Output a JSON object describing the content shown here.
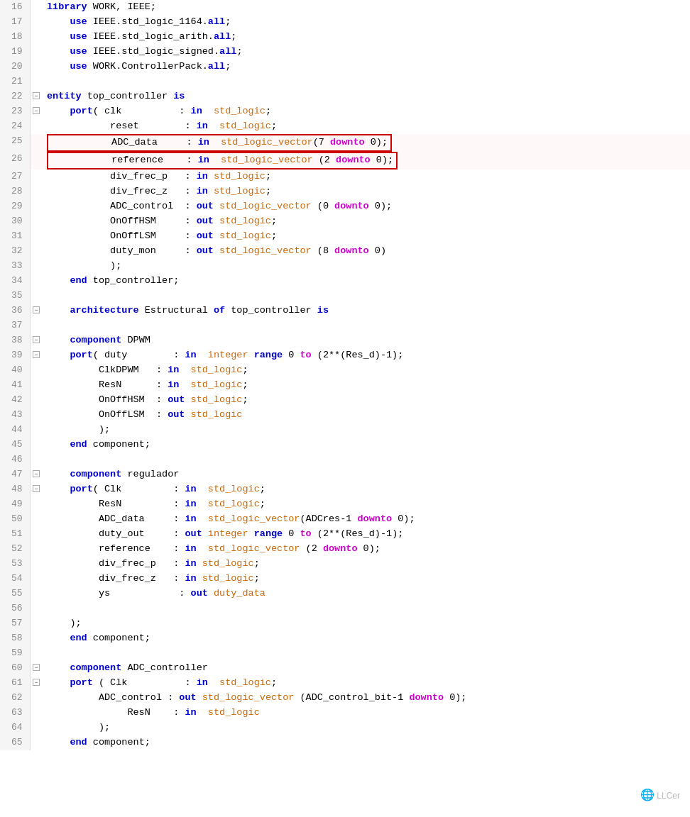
{
  "lines": [
    {
      "num": 16,
      "fold": "",
      "code": [
        {
          "t": "library",
          "c": "kw"
        },
        {
          "t": " WORK, IEEE;",
          "c": ""
        }
      ]
    },
    {
      "num": 17,
      "fold": "",
      "code": [
        {
          "t": "    use",
          "c": "kw"
        },
        {
          "t": " IEEE.std_logic_1164.",
          "c": ""
        },
        {
          "t": "all",
          "c": "kw"
        },
        {
          "t": ";",
          "c": ""
        }
      ]
    },
    {
      "num": 18,
      "fold": "",
      "code": [
        {
          "t": "    use",
          "c": "kw"
        },
        {
          "t": " IEEE.std_logic_arith.",
          "c": ""
        },
        {
          "t": "all",
          "c": "kw"
        },
        {
          "t": ";",
          "c": ""
        }
      ]
    },
    {
      "num": 19,
      "fold": "",
      "code": [
        {
          "t": "    use",
          "c": "kw"
        },
        {
          "t": " IEEE.std_logic_signed.",
          "c": ""
        },
        {
          "t": "all",
          "c": "kw"
        },
        {
          "t": ";",
          "c": ""
        }
      ]
    },
    {
      "num": 20,
      "fold": "",
      "code": [
        {
          "t": "    use",
          "c": "kw"
        },
        {
          "t": " WORK.ControllerPack.",
          "c": ""
        },
        {
          "t": "all",
          "c": "kw"
        },
        {
          "t": ";",
          "c": ""
        }
      ]
    },
    {
      "num": 21,
      "fold": "",
      "code": []
    },
    {
      "num": 22,
      "fold": "minus",
      "code": [
        {
          "t": "entity",
          "c": "kw"
        },
        {
          "t": " top_controller ",
          "c": ""
        },
        {
          "t": "is",
          "c": "kw"
        }
      ]
    },
    {
      "num": 23,
      "fold": "minus",
      "code": [
        {
          "t": "    port",
          "c": "kw"
        },
        {
          "t": "( clk          : ",
          "c": ""
        },
        {
          "t": "in",
          "c": "kw"
        },
        {
          "t": "  ",
          "c": ""
        },
        {
          "t": "std_logic",
          "c": "type"
        },
        {
          "t": ";",
          "c": ""
        }
      ]
    },
    {
      "num": 24,
      "fold": "",
      "code": [
        {
          "t": "           reset        : ",
          "c": ""
        },
        {
          "t": "in",
          "c": "kw"
        },
        {
          "t": "  ",
          "c": ""
        },
        {
          "t": "std_logic",
          "c": "type"
        },
        {
          "t": ";",
          "c": ""
        }
      ]
    },
    {
      "num": 25,
      "fold": "",
      "code": [
        {
          "t": "           ADC_data     : ",
          "c": ""
        },
        {
          "t": "in",
          "c": "kw"
        },
        {
          "t": "  ",
          "c": ""
        },
        {
          "t": "std_logic_vector",
          "c": "type"
        },
        {
          "t": "(7 ",
          "c": ""
        },
        {
          "t": "downto",
          "c": "kw2"
        },
        {
          "t": " 0);",
          "c": ""
        }
      ],
      "redbox": true
    },
    {
      "num": 26,
      "fold": "",
      "code": [
        {
          "t": "           reference    : ",
          "c": ""
        },
        {
          "t": "in",
          "c": "kw"
        },
        {
          "t": "  ",
          "c": ""
        },
        {
          "t": "std_logic_vector",
          "c": "type"
        },
        {
          "t": " (2 ",
          "c": ""
        },
        {
          "t": "downto",
          "c": "kw2"
        },
        {
          "t": " 0);",
          "c": ""
        }
      ],
      "redbox": true
    },
    {
      "num": 27,
      "fold": "",
      "code": [
        {
          "t": "           div_frec_p   : ",
          "c": ""
        },
        {
          "t": "in",
          "c": "kw"
        },
        {
          "t": " ",
          "c": ""
        },
        {
          "t": "std_logic",
          "c": "type"
        },
        {
          "t": ";",
          "c": ""
        }
      ]
    },
    {
      "num": 28,
      "fold": "",
      "code": [
        {
          "t": "           div_frec_z   : ",
          "c": ""
        },
        {
          "t": "in",
          "c": "kw"
        },
        {
          "t": " ",
          "c": ""
        },
        {
          "t": "std_logic",
          "c": "type"
        },
        {
          "t": ";",
          "c": ""
        }
      ]
    },
    {
      "num": 29,
      "fold": "",
      "code": [
        {
          "t": "           ADC_control  : ",
          "c": ""
        },
        {
          "t": "out",
          "c": "kw"
        },
        {
          "t": " ",
          "c": ""
        },
        {
          "t": "std_logic_vector",
          "c": "type"
        },
        {
          "t": " (0 ",
          "c": ""
        },
        {
          "t": "downto",
          "c": "kw2"
        },
        {
          "t": " 0);",
          "c": ""
        }
      ]
    },
    {
      "num": 30,
      "fold": "",
      "code": [
        {
          "t": "           OnOffHSM     : ",
          "c": ""
        },
        {
          "t": "out",
          "c": "kw"
        },
        {
          "t": " ",
          "c": ""
        },
        {
          "t": "std_logic",
          "c": "type"
        },
        {
          "t": ";",
          "c": ""
        }
      ]
    },
    {
      "num": 31,
      "fold": "",
      "code": [
        {
          "t": "           OnOffLSM     : ",
          "c": ""
        },
        {
          "t": "out",
          "c": "kw"
        },
        {
          "t": " ",
          "c": ""
        },
        {
          "t": "std_logic",
          "c": "type"
        },
        {
          "t": ";",
          "c": ""
        }
      ]
    },
    {
      "num": 32,
      "fold": "",
      "code": [
        {
          "t": "           duty_mon     : ",
          "c": ""
        },
        {
          "t": "out",
          "c": "kw"
        },
        {
          "t": " ",
          "c": ""
        },
        {
          "t": "std_logic_vector",
          "c": "type"
        },
        {
          "t": " (8 ",
          "c": ""
        },
        {
          "t": "downto",
          "c": "kw2"
        },
        {
          "t": " 0)",
          "c": ""
        }
      ]
    },
    {
      "num": 33,
      "fold": "",
      "code": [
        {
          "t": "           );",
          "c": ""
        }
      ]
    },
    {
      "num": 34,
      "fold": "",
      "code": [
        {
          "t": "    end",
          "c": "kw"
        },
        {
          "t": " top_controller;",
          "c": ""
        }
      ]
    },
    {
      "num": 35,
      "fold": "",
      "code": []
    },
    {
      "num": 36,
      "fold": "minus",
      "code": [
        {
          "t": "    architecture",
          "c": "kw"
        },
        {
          "t": " Estructural ",
          "c": ""
        },
        {
          "t": "of",
          "c": "kw"
        },
        {
          "t": " top_controller ",
          "c": ""
        },
        {
          "t": "is",
          "c": "kw"
        }
      ]
    },
    {
      "num": 37,
      "fold": "",
      "code": []
    },
    {
      "num": 38,
      "fold": "minus",
      "code": [
        {
          "t": "    component",
          "c": "kw"
        },
        {
          "t": " DPWM",
          "c": ""
        }
      ]
    },
    {
      "num": 39,
      "fold": "minus",
      "code": [
        {
          "t": "    port",
          "c": "kw"
        },
        {
          "t": "( duty        : ",
          "c": ""
        },
        {
          "t": "in",
          "c": "kw"
        },
        {
          "t": "  ",
          "c": ""
        },
        {
          "t": "integer",
          "c": "type"
        },
        {
          "t": " ",
          "c": ""
        },
        {
          "t": "range",
          "c": "kw"
        },
        {
          "t": " 0 ",
          "c": ""
        },
        {
          "t": "to",
          "c": "kw2"
        },
        {
          "t": " (2**(Res_d)-1);",
          "c": ""
        }
      ]
    },
    {
      "num": 40,
      "fold": "",
      "code": [
        {
          "t": "         ClkDPWM   : ",
          "c": ""
        },
        {
          "t": "in",
          "c": "kw"
        },
        {
          "t": "  ",
          "c": ""
        },
        {
          "t": "std_logic",
          "c": "type"
        },
        {
          "t": ";",
          "c": ""
        }
      ]
    },
    {
      "num": 41,
      "fold": "",
      "code": [
        {
          "t": "         ResN      : ",
          "c": ""
        },
        {
          "t": "in",
          "c": "kw"
        },
        {
          "t": "  ",
          "c": ""
        },
        {
          "t": "std_logic",
          "c": "type"
        },
        {
          "t": ";",
          "c": ""
        }
      ]
    },
    {
      "num": 42,
      "fold": "",
      "code": [
        {
          "t": "         OnOffHSM  : ",
          "c": ""
        },
        {
          "t": "out",
          "c": "kw"
        },
        {
          "t": " ",
          "c": ""
        },
        {
          "t": "std_logic",
          "c": "type"
        },
        {
          "t": ";",
          "c": ""
        }
      ]
    },
    {
      "num": 43,
      "fold": "",
      "code": [
        {
          "t": "         OnOffLSM  : ",
          "c": ""
        },
        {
          "t": "out",
          "c": "kw"
        },
        {
          "t": " ",
          "c": ""
        },
        {
          "t": "std_logic",
          "c": "type"
        },
        {
          "t": "",
          "c": ""
        }
      ]
    },
    {
      "num": 44,
      "fold": "",
      "code": [
        {
          "t": "         );",
          "c": ""
        }
      ]
    },
    {
      "num": 45,
      "fold": "",
      "code": [
        {
          "t": "    end",
          "c": "kw"
        },
        {
          "t": " component;",
          "c": ""
        }
      ]
    },
    {
      "num": 46,
      "fold": "",
      "code": []
    },
    {
      "num": 47,
      "fold": "minus",
      "code": [
        {
          "t": "    component",
          "c": "kw"
        },
        {
          "t": " regulador",
          "c": ""
        }
      ]
    },
    {
      "num": 48,
      "fold": "minus",
      "code": [
        {
          "t": "    port",
          "c": "kw"
        },
        {
          "t": "( Clk         : ",
          "c": ""
        },
        {
          "t": "in",
          "c": "kw"
        },
        {
          "t": "  ",
          "c": ""
        },
        {
          "t": "std_logic",
          "c": "type"
        },
        {
          "t": ";",
          "c": ""
        }
      ]
    },
    {
      "num": 49,
      "fold": "",
      "code": [
        {
          "t": "         ResN         : ",
          "c": ""
        },
        {
          "t": "in",
          "c": "kw"
        },
        {
          "t": "  ",
          "c": ""
        },
        {
          "t": "std_logic",
          "c": "type"
        },
        {
          "t": ";",
          "c": ""
        }
      ]
    },
    {
      "num": 50,
      "fold": "",
      "code": [
        {
          "t": "         ADC_data     : ",
          "c": ""
        },
        {
          "t": "in",
          "c": "kw"
        },
        {
          "t": "  ",
          "c": ""
        },
        {
          "t": "std_logic_vector",
          "c": "type"
        },
        {
          "t": "(ADCres-1 ",
          "c": ""
        },
        {
          "t": "downto",
          "c": "kw2"
        },
        {
          "t": " 0);",
          "c": ""
        }
      ]
    },
    {
      "num": 51,
      "fold": "",
      "code": [
        {
          "t": "         duty_out     : ",
          "c": ""
        },
        {
          "t": "out",
          "c": "kw"
        },
        {
          "t": " ",
          "c": ""
        },
        {
          "t": "integer",
          "c": "type"
        },
        {
          "t": " ",
          "c": ""
        },
        {
          "t": "range",
          "c": "kw"
        },
        {
          "t": " 0 ",
          "c": ""
        },
        {
          "t": "to",
          "c": "kw2"
        },
        {
          "t": " (2**(Res_d)-1);",
          "c": ""
        }
      ]
    },
    {
      "num": 52,
      "fold": "",
      "code": [
        {
          "t": "         reference    : ",
          "c": ""
        },
        {
          "t": "in",
          "c": "kw"
        },
        {
          "t": "  ",
          "c": ""
        },
        {
          "t": "std_logic_vector",
          "c": "type"
        },
        {
          "t": " (2 ",
          "c": ""
        },
        {
          "t": "downto",
          "c": "kw2"
        },
        {
          "t": " 0);",
          "c": ""
        }
      ]
    },
    {
      "num": 53,
      "fold": "",
      "code": [
        {
          "t": "         div_frec_p   : ",
          "c": ""
        },
        {
          "t": "in",
          "c": "kw"
        },
        {
          "t": " ",
          "c": ""
        },
        {
          "t": "std_logic",
          "c": "type"
        },
        {
          "t": ";",
          "c": ""
        }
      ]
    },
    {
      "num": 54,
      "fold": "",
      "code": [
        {
          "t": "         div_frec_z   : ",
          "c": ""
        },
        {
          "t": "in",
          "c": "kw"
        },
        {
          "t": " ",
          "c": ""
        },
        {
          "t": "std_logic",
          "c": "type"
        },
        {
          "t": ";",
          "c": ""
        }
      ]
    },
    {
      "num": 55,
      "fold": "",
      "code": [
        {
          "t": "         ys            : ",
          "c": ""
        },
        {
          "t": "out",
          "c": "kw"
        },
        {
          "t": " duty_data",
          "c": "type"
        }
      ]
    },
    {
      "num": 56,
      "fold": "",
      "code": []
    },
    {
      "num": 57,
      "fold": "",
      "code": [
        {
          "t": "    );",
          "c": ""
        }
      ]
    },
    {
      "num": 58,
      "fold": "",
      "code": [
        {
          "t": "    end",
          "c": "kw"
        },
        {
          "t": " component;",
          "c": ""
        }
      ]
    },
    {
      "num": 59,
      "fold": "",
      "code": []
    },
    {
      "num": 60,
      "fold": "minus",
      "code": [
        {
          "t": "    component",
          "c": "kw"
        },
        {
          "t": " ADC_controller",
          "c": ""
        }
      ]
    },
    {
      "num": 61,
      "fold": "minus",
      "code": [
        {
          "t": "    port",
          "c": "kw"
        },
        {
          "t": " ( Clk          : ",
          "c": ""
        },
        {
          "t": "in",
          "c": "kw"
        },
        {
          "t": "  ",
          "c": ""
        },
        {
          "t": "std_logic",
          "c": "type"
        },
        {
          "t": ";",
          "c": ""
        }
      ]
    },
    {
      "num": 62,
      "fold": "",
      "code": [
        {
          "t": "         ADC_control : ",
          "c": ""
        },
        {
          "t": "out",
          "c": "kw"
        },
        {
          "t": " ",
          "c": ""
        },
        {
          "t": "std_logic_vector",
          "c": "type"
        },
        {
          "t": " (ADC_control_bit-1 ",
          "c": ""
        },
        {
          "t": "downto",
          "c": "kw2"
        },
        {
          "t": " 0);",
          "c": ""
        }
      ]
    },
    {
      "num": 63,
      "fold": "",
      "code": [
        {
          "t": "              ResN    : ",
          "c": ""
        },
        {
          "t": "in",
          "c": "kw"
        },
        {
          "t": "  ",
          "c": ""
        },
        {
          "t": "std_logic",
          "c": "type"
        }
      ]
    },
    {
      "num": 64,
      "fold": "",
      "code": [
        {
          "t": "         );",
          "c": ""
        }
      ]
    },
    {
      "num": 65,
      "fold": "",
      "code": [
        {
          "t": "    end",
          "c": "kw"
        },
        {
          "t": " component;",
          "c": ""
        }
      ]
    }
  ],
  "watermark": "LLCer",
  "redbox_lines": [
    25,
    26
  ]
}
